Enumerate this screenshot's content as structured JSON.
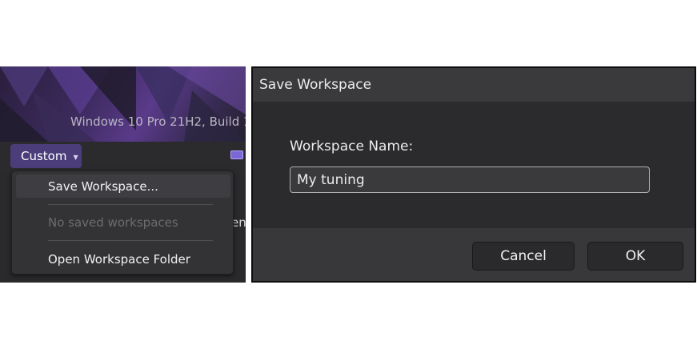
{
  "left_panel": {
    "os_version": "Windows 10 Pro 21H2, Build 1",
    "profile_dropdown": {
      "label": "Custom"
    },
    "background_text_fragment": "en",
    "menu": {
      "items": [
        {
          "label": "Save Workspace...",
          "enabled": true,
          "highlighted": true
        },
        {
          "label": "No saved workspaces",
          "enabled": false,
          "highlighted": false
        },
        {
          "label": "Open Workspace Folder",
          "enabled": true,
          "highlighted": false
        }
      ]
    }
  },
  "dialog": {
    "title": "Save Workspace",
    "field_label": "Workspace Name:",
    "input_value": "My tuning",
    "buttons": {
      "cancel": "Cancel",
      "ok": "OK"
    }
  },
  "colors": {
    "accent": "#4a3d7a",
    "toggle": "#7c67d6",
    "dialog_bg": "#2e2e30",
    "menu_bg": "#333335"
  },
  "icons": {
    "dropdown_chevron": "chevron-down-icon"
  }
}
